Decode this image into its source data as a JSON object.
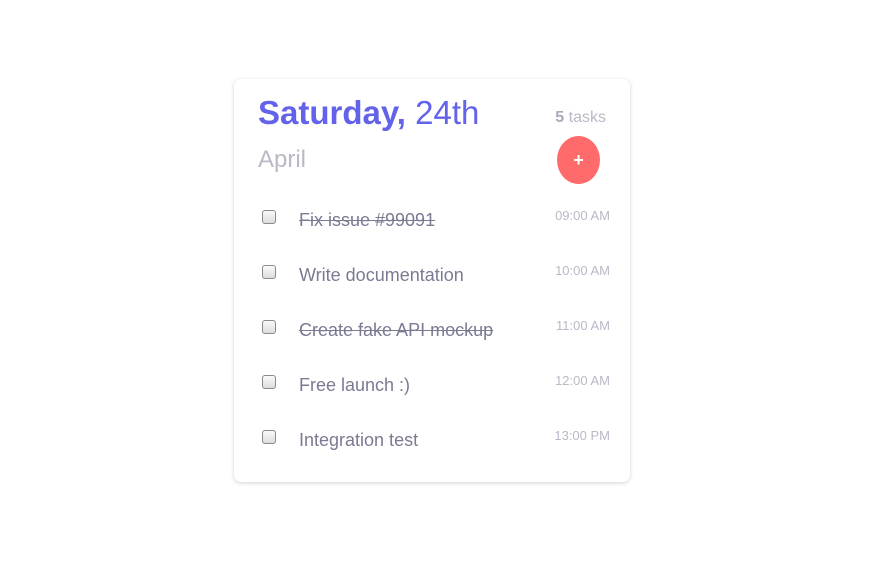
{
  "header": {
    "day": "Saturday,",
    "date": "24th",
    "month": "April",
    "task_count": "5",
    "task_count_label": "tasks",
    "add_button_label": "+"
  },
  "tasks": [
    {
      "name": "Fix issue #99091",
      "time": "09:00 AM",
      "done": true
    },
    {
      "name": "Write documentation",
      "time": "10:00 AM",
      "done": false
    },
    {
      "name": "Create fake API mockup",
      "time": "11:00 AM",
      "done": true
    },
    {
      "name": "Free launch :)",
      "time": "12:00 AM",
      "done": false
    },
    {
      "name": "Integration test",
      "time": "13:00 PM",
      "done": false
    }
  ],
  "colors": {
    "accent": "#6262ea",
    "add_button": "#ff6b6b",
    "muted_text": "#b9b9c7",
    "task_text": "#7a7a92"
  }
}
